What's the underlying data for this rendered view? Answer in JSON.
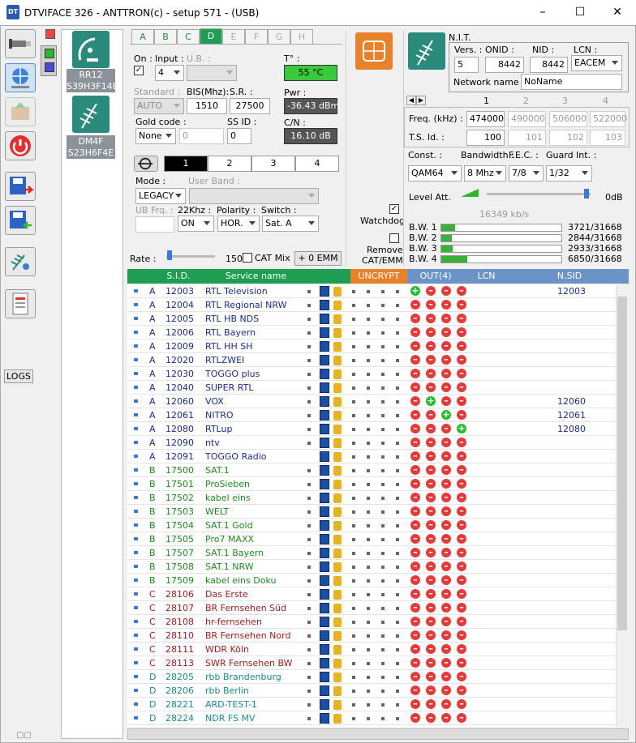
{
  "window": {
    "title": "DTVIFACE 326 - ANTTRON(c) - setup 571 - (USB)",
    "minimize": "–",
    "maximize": "☐",
    "close": "✕"
  },
  "toolbar": {
    "logs_label": "LOGS"
  },
  "devices": [
    {
      "name": "RR12",
      "id": "S39H3F14E"
    },
    {
      "name": "DM4F",
      "id": "S23H6F4E"
    }
  ],
  "tabs": [
    "A",
    "B",
    "C",
    "D",
    "E",
    "F",
    "G",
    "H"
  ],
  "tuner": {
    "on_label": "On :",
    "input_label": "Input :",
    "input_value": "4",
    "ub_label": "U.B. :",
    "temp_label": "T° :",
    "temp_value": "55 °C",
    "standard_label": "Standard :",
    "standard_value": "AUTO",
    "bis_label": "BIS(Mhz):",
    "bis_value": "1510",
    "sr_label": "S.R. :",
    "sr_value": "27500",
    "pwr_label": "Pwr :",
    "pwr_value": "-36.43 dBm",
    "gold_label": "Gold code :",
    "gold_value": "None",
    "gold_num": "0",
    "ssid_label": "SS ID :",
    "ssid_value": "0",
    "cn_label": "C/N :",
    "cn_value": "16.10 dB",
    "segments": [
      "1",
      "2",
      "3",
      "4"
    ],
    "mode_label": "Mode :",
    "mode_value": "LEGACY",
    "userband_label": "User Band :",
    "ubfrq_label": "UB Frq. :",
    "k22_label": "22Khz :",
    "k22_value": "ON",
    "polarity_label": "Polarity :",
    "polarity_value": "HOR.",
    "switch_label": "Switch :",
    "switch_value": "Sat. A",
    "rate_label": "Rate :",
    "rate_value": "150",
    "catmix_label": "CAT Mix",
    "emm_button": "+ 0 EMM",
    "watchdog_label": "Watchdog",
    "remove_label": "Remove CAT/EMM"
  },
  "nit": {
    "title": "N.I.T.",
    "vers_label": "Vers. :",
    "vers_value": "5",
    "onid_label": "ONID :",
    "onid_value": "8442",
    "nid_label": "NID :",
    "nid_value": "8442",
    "lcn_label": "LCN :",
    "lcn_value": "EACEM",
    "netname_label": "Network name :",
    "netname_value": "NoName"
  },
  "mux": {
    "cols": [
      "1",
      "2",
      "3",
      "4"
    ],
    "freq_label": "Freq. (kHz) :",
    "freq_values": [
      "474000",
      "490000",
      "506000",
      "522000"
    ],
    "tsid_label": "T.S. Id. :",
    "tsid_values": [
      "100",
      "101",
      "102",
      "103"
    ],
    "const_label": "Const. :",
    "const_value": "QAM64",
    "bw_label": "Bandwidth :",
    "bw_value": "8 Mhz",
    "fec_label": "F.E.C. :",
    "fec_value": "7/8",
    "guard_label": "Guard Int. :",
    "guard_value": "1/32",
    "level_label": "Level Att.",
    "level_value": "0dB",
    "bitrate": "16349 kb/s",
    "bw": [
      {
        "label": "B.W. 1",
        "value": "3721/31668",
        "fill": 0.117
      },
      {
        "label": "B.W. 2",
        "value": "2844/31668",
        "fill": 0.09
      },
      {
        "label": "B.W. 3",
        "value": "2933/31668",
        "fill": 0.093
      },
      {
        "label": "B.W. 4",
        "value": "6850/31668",
        "fill": 0.216
      }
    ]
  },
  "table": {
    "headers": {
      "sid": "S.I.D.",
      "service": "Service name",
      "uncrypt": "UNCRYPT",
      "out": "OUT(4)",
      "lcn": "LCN",
      "nsid": "N.SID"
    },
    "colors": {
      "green": "#1e9e52",
      "orange": "#e8822a",
      "blue": "#6b93c8"
    },
    "rows": [
      {
        "tuner": "A",
        "sid": "12003",
        "name": "RTL Television",
        "out": [
          "g",
          "r",
          "r",
          "r"
        ],
        "nsid": "12003",
        "radio": false
      },
      {
        "tuner": "A",
        "sid": "12004",
        "name": "RTL Regional NRW",
        "out": [
          "r",
          "r",
          "r",
          "r"
        ],
        "nsid": "",
        "radio": false
      },
      {
        "tuner": "A",
        "sid": "12005",
        "name": "RTL HB NDS",
        "out": [
          "r",
          "r",
          "r",
          "r"
        ],
        "nsid": "",
        "radio": false
      },
      {
        "tuner": "A",
        "sid": "12006",
        "name": "RTL Bayern",
        "out": [
          "r",
          "r",
          "r",
          "r"
        ],
        "nsid": "",
        "radio": false
      },
      {
        "tuner": "A",
        "sid": "12009",
        "name": "RTL HH SH",
        "out": [
          "r",
          "r",
          "r",
          "r"
        ],
        "nsid": "",
        "radio": false
      },
      {
        "tuner": "A",
        "sid": "12020",
        "name": "RTLZWEI",
        "out": [
          "r",
          "r",
          "r",
          "r"
        ],
        "nsid": "",
        "radio": false
      },
      {
        "tuner": "A",
        "sid": "12030",
        "name": "TOGGO plus",
        "out": [
          "r",
          "r",
          "r",
          "r"
        ],
        "nsid": "",
        "radio": false
      },
      {
        "tuner": "A",
        "sid": "12040",
        "name": "SUPER RTL",
        "out": [
          "r",
          "r",
          "r",
          "r"
        ],
        "nsid": "",
        "radio": false
      },
      {
        "tuner": "A",
        "sid": "12060",
        "name": "VOX",
        "out": [
          "r",
          "g",
          "r",
          "r"
        ],
        "nsid": "12060",
        "radio": false
      },
      {
        "tuner": "A",
        "sid": "12061",
        "name": "NITRO",
        "out": [
          "r",
          "r",
          "g",
          "r"
        ],
        "nsid": "12061",
        "radio": false
      },
      {
        "tuner": "A",
        "sid": "12080",
        "name": "RTLup",
        "out": [
          "r",
          "r",
          "r",
          "g"
        ],
        "nsid": "12080",
        "radio": false
      },
      {
        "tuner": "A",
        "sid": "12090",
        "name": "ntv",
        "out": [
          "r",
          "r",
          "r",
          "r"
        ],
        "nsid": "",
        "radio": false
      },
      {
        "tuner": "A",
        "sid": "12091",
        "name": "TOGGO Radio",
        "out": [
          "r",
          "r",
          "r",
          "r"
        ],
        "nsid": "",
        "radio": true
      },
      {
        "tuner": "B",
        "sid": "17500",
        "name": "SAT.1",
        "out": [
          "r",
          "r",
          "r",
          "r"
        ],
        "nsid": "",
        "radio": false
      },
      {
        "tuner": "B",
        "sid": "17501",
        "name": "ProSieben",
        "out": [
          "r",
          "r",
          "r",
          "r"
        ],
        "nsid": "",
        "radio": false
      },
      {
        "tuner": "B",
        "sid": "17502",
        "name": "kabel eins",
        "out": [
          "r",
          "r",
          "r",
          "r"
        ],
        "nsid": "",
        "radio": false
      },
      {
        "tuner": "B",
        "sid": "17503",
        "name": "WELT",
        "out": [
          "r",
          "r",
          "r",
          "r"
        ],
        "nsid": "",
        "radio": false
      },
      {
        "tuner": "B",
        "sid": "17504",
        "name": "SAT.1 Gold",
        "out": [
          "r",
          "r",
          "r",
          "r"
        ],
        "nsid": "",
        "radio": false
      },
      {
        "tuner": "B",
        "sid": "17505",
        "name": "Pro7 MAXX",
        "out": [
          "r",
          "r",
          "r",
          "r"
        ],
        "nsid": "",
        "radio": false
      },
      {
        "tuner": "B",
        "sid": "17507",
        "name": "SAT.1 Bayern",
        "out": [
          "r",
          "r",
          "r",
          "r"
        ],
        "nsid": "",
        "radio": false
      },
      {
        "tuner": "B",
        "sid": "17508",
        "name": "SAT.1 NRW",
        "out": [
          "r",
          "r",
          "r",
          "r"
        ],
        "nsid": "",
        "radio": false
      },
      {
        "tuner": "B",
        "sid": "17509",
        "name": "kabel eins Doku",
        "out": [
          "r",
          "r",
          "r",
          "r"
        ],
        "nsid": "",
        "radio": false
      },
      {
        "tuner": "C",
        "sid": "28106",
        "name": "Das Erste",
        "out": [
          "r",
          "r",
          "r",
          "r"
        ],
        "nsid": "",
        "radio": false
      },
      {
        "tuner": "C",
        "sid": "28107",
        "name": "BR Fernsehen Süd",
        "out": [
          "r",
          "r",
          "r",
          "r"
        ],
        "nsid": "",
        "radio": false
      },
      {
        "tuner": "C",
        "sid": "28108",
        "name": "hr-fernsehen",
        "out": [
          "r",
          "r",
          "r",
          "r"
        ],
        "nsid": "",
        "radio": false
      },
      {
        "tuner": "C",
        "sid": "28110",
        "name": "BR Fernsehen Nord",
        "out": [
          "r",
          "r",
          "r",
          "r"
        ],
        "nsid": "",
        "radio": false
      },
      {
        "tuner": "C",
        "sid": "28111",
        "name": "WDR Köln",
        "out": [
          "r",
          "r",
          "r",
          "r"
        ],
        "nsid": "",
        "radio": false
      },
      {
        "tuner": "C",
        "sid": "28113",
        "name": "SWR Fernsehen BW",
        "out": [
          "r",
          "r",
          "r",
          "r"
        ],
        "nsid": "",
        "radio": false
      },
      {
        "tuner": "D",
        "sid": "28205",
        "name": "rbb Brandenburg",
        "out": [
          "r",
          "r",
          "r",
          "r"
        ],
        "nsid": "",
        "radio": false
      },
      {
        "tuner": "D",
        "sid": "28206",
        "name": "rbb Berlin",
        "out": [
          "r",
          "r",
          "r",
          "r"
        ],
        "nsid": "",
        "radio": false
      },
      {
        "tuner": "D",
        "sid": "28221",
        "name": "ARD-TEST-1",
        "out": [
          "r",
          "r",
          "r",
          "r"
        ],
        "nsid": "",
        "radio": false
      },
      {
        "tuner": "D",
        "sid": "28224",
        "name": "NDR FS MV",
        "out": [
          "r",
          "r",
          "r",
          "r"
        ],
        "nsid": "",
        "radio": false
      }
    ]
  }
}
